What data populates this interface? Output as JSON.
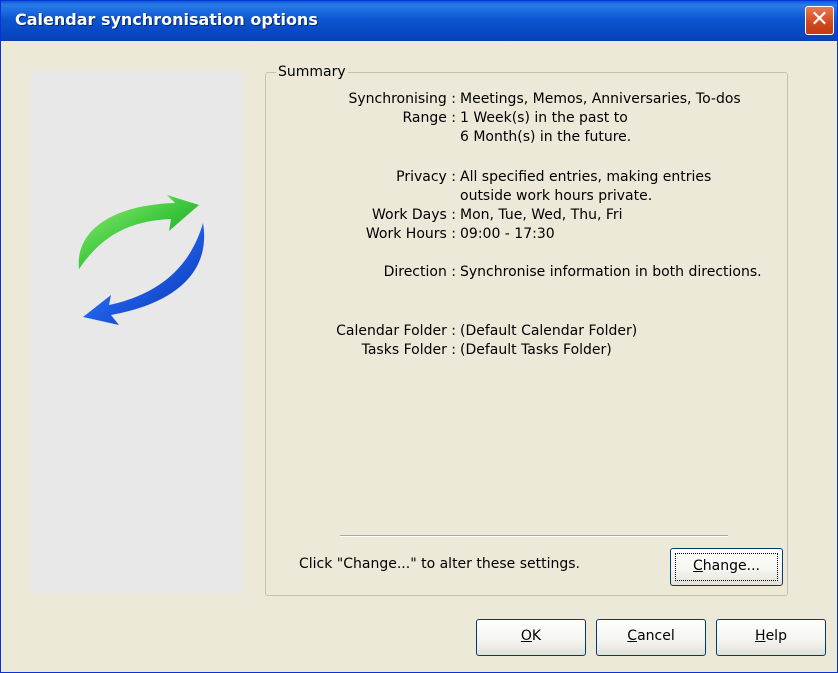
{
  "window": {
    "title": "Calendar synchronisation options",
    "close_symbol": "✕"
  },
  "summary": {
    "group_title": "Summary",
    "rows": [
      {
        "label": "Synchronising :",
        "value": "Meetings, Memos, Anniversaries, To-dos"
      },
      {
        "label": "Range :",
        "value": "1 Week(s) in the past to"
      },
      {
        "label": "",
        "value": "6 Month(s) in the future."
      },
      {
        "label": "Privacy :",
        "value": "All specified entries, making entries"
      },
      {
        "label": "",
        "value": "outside work hours private."
      },
      {
        "label": "Work Days :",
        "value": "Mon, Tue, Wed, Thu, Fri"
      },
      {
        "label": "Work Hours :",
        "value": "09:00 - 17:30"
      },
      {
        "label": "Direction :",
        "value": "Synchronise information in both directions."
      },
      {
        "label": "Calendar Folder :",
        "value": "(Default Calendar Folder)"
      },
      {
        "label": "Tasks Folder :",
        "value": "(Default Tasks Folder)"
      }
    ],
    "hint": "Click \"Change...\" to alter these settings.",
    "change_button": {
      "mnemonic": "C",
      "rest": "hange..."
    }
  },
  "buttons": {
    "ok": {
      "mnemonic": "O",
      "rest": "K"
    },
    "cancel": {
      "mnemonic": "C",
      "rest": "ancel"
    },
    "help": {
      "mnemonic": "H",
      "rest": "elp"
    }
  },
  "logo": {
    "icon": "sync-arrows-icon",
    "colors": [
      "#3cc83c",
      "#1e5ee6"
    ]
  },
  "colors": {
    "titlebar": "#0846bf",
    "dialog_bg": "#ece9d8",
    "close_button": "#d44a1f"
  }
}
